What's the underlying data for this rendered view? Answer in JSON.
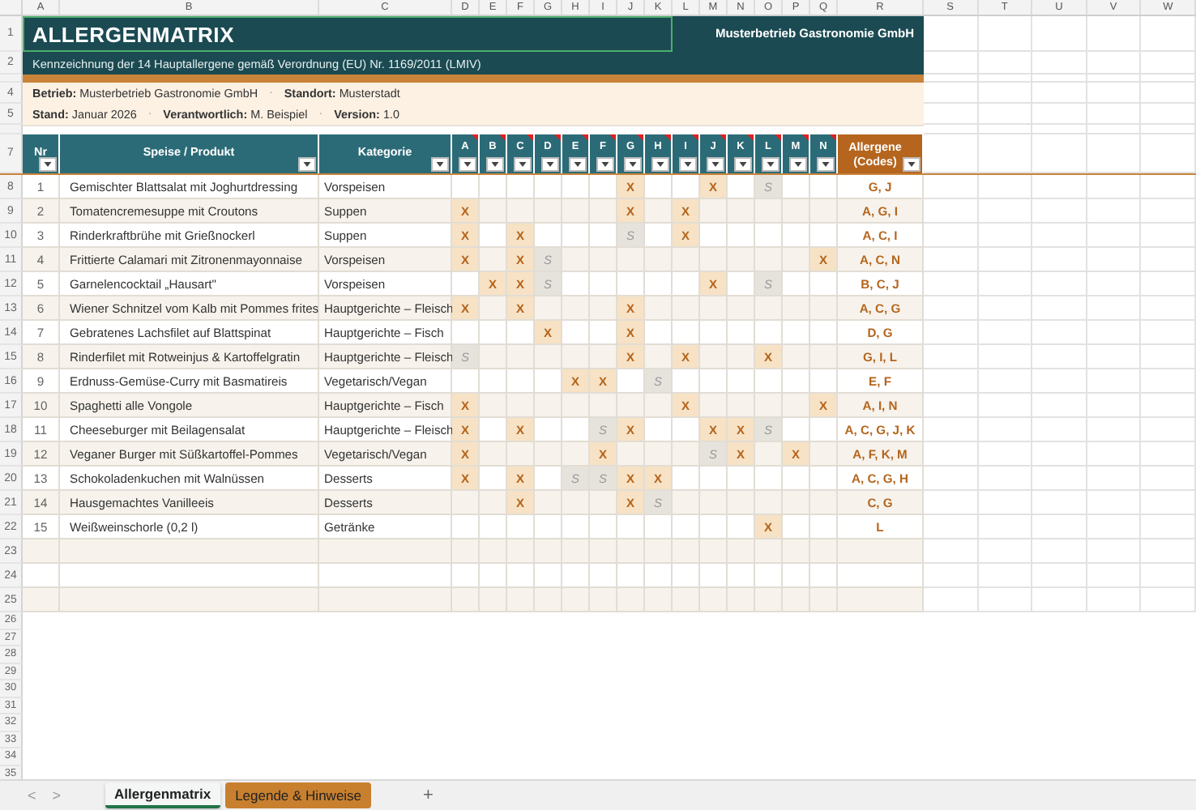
{
  "column_headers": [
    "A",
    "B",
    "C",
    "D",
    "E",
    "F",
    "G",
    "H",
    "I",
    "J",
    "K",
    "L",
    "M",
    "N",
    "O",
    "P",
    "Q",
    "R",
    "S",
    "T",
    "U",
    "V",
    "W"
  ],
  "row_numbers": [
    "1",
    "2",
    "4",
    "5",
    "7",
    "8",
    "9",
    "10",
    "11",
    "12",
    "13",
    "14",
    "15",
    "16",
    "17",
    "18",
    "19",
    "20",
    "21",
    "22",
    "23",
    "24",
    "25",
    "26",
    "27",
    "28",
    "29",
    "30",
    "31",
    "32",
    "33",
    "34",
    "35"
  ],
  "title": "ALLERGENMATRIX",
  "company": "Musterbetrieb Gastronomie GmbH",
  "subtitle": "Kennzeichnung der 14 Hauptallergene gemäß Verordnung (EU) Nr. 1169/2011 (LMIV)",
  "info_lines": [
    [
      "**Betrieb:** Musterbetrieb Gastronomie GmbH",
      "**Standort:** Musterstadt"
    ],
    [
      "**Stand:** Januar 2026",
      "**Verantwortlich:** M. Beispiel",
      "**Version:** 1.0"
    ]
  ],
  "info_separator": "·",
  "table": {
    "columns": [
      "Nr",
      "Speise / Produkt",
      "Kategorie"
    ],
    "allergen_columns": [
      "A",
      "B",
      "C",
      "D",
      "E",
      "F",
      "G",
      "H",
      "I",
      "J",
      "K",
      "L",
      "M",
      "N"
    ],
    "codes_column": "Allergene (Codes)",
    "rows": [
      {
        "nr": "1",
        "dish": "Gemischter Blattsalat mit Joghurtdressing",
        "category": "Vorspeisen",
        "marks": [
          {
            "kind": "none"
          },
          {
            "kind": "none"
          },
          {
            "kind": "none"
          },
          {
            "kind": "none"
          },
          {
            "kind": "none"
          },
          {
            "kind": "none"
          },
          {
            "kind": "contains",
            "text": "X"
          },
          {
            "kind": "none"
          },
          {
            "kind": "none"
          },
          {
            "kind": "contains",
            "text": "X"
          },
          {
            "kind": "none"
          },
          {
            "kind": "trace",
            "text": "S"
          },
          {
            "kind": "none"
          },
          {
            "kind": "none"
          }
        ],
        "codes": "G, J"
      },
      {
        "nr": "2",
        "dish": "Tomatencremesuppe mit Croutons",
        "category": "Suppen",
        "marks": [
          {
            "kind": "contains",
            "text": "X"
          },
          {
            "kind": "none"
          },
          {
            "kind": "none"
          },
          {
            "kind": "none"
          },
          {
            "kind": "none"
          },
          {
            "kind": "none"
          },
          {
            "kind": "contains",
            "text": "X"
          },
          {
            "kind": "none"
          },
          {
            "kind": "contains",
            "text": "X"
          },
          {
            "kind": "none"
          },
          {
            "kind": "none"
          },
          {
            "kind": "none"
          },
          {
            "kind": "none"
          },
          {
            "kind": "none"
          }
        ],
        "codes": "A, G, I"
      },
      {
        "nr": "3",
        "dish": "Rinderkraftbrühe mit Grießnockerl",
        "category": "Suppen",
        "marks": [
          {
            "kind": "contains",
            "text": "X"
          },
          {
            "kind": "none"
          },
          {
            "kind": "contains",
            "text": "X"
          },
          {
            "kind": "none"
          },
          {
            "kind": "none"
          },
          {
            "kind": "none"
          },
          {
            "kind": "trace",
            "text": "S"
          },
          {
            "kind": "none"
          },
          {
            "kind": "contains",
            "text": "X"
          },
          {
            "kind": "none"
          },
          {
            "kind": "none"
          },
          {
            "kind": "none"
          },
          {
            "kind": "none"
          },
          {
            "kind": "none"
          }
        ],
        "codes": "A, C, I"
      },
      {
        "nr": "4",
        "dish": "Frittierte Calamari mit Zitronenmayonnaise",
        "category": "Vorspeisen",
        "marks": [
          {
            "kind": "contains",
            "text": "X"
          },
          {
            "kind": "none"
          },
          {
            "kind": "contains",
            "text": "X"
          },
          {
            "kind": "trace",
            "text": "S"
          },
          {
            "kind": "none"
          },
          {
            "kind": "none"
          },
          {
            "kind": "none"
          },
          {
            "kind": "none"
          },
          {
            "kind": "none"
          },
          {
            "kind": "none"
          },
          {
            "kind": "none"
          },
          {
            "kind": "none"
          },
          {
            "kind": "none"
          },
          {
            "kind": "contains",
            "text": "X"
          }
        ],
        "codes": "A, C, N"
      },
      {
        "nr": "5",
        "dish": "Garnelencocktail „Hausart\"",
        "category": "Vorspeisen",
        "marks": [
          {
            "kind": "none"
          },
          {
            "kind": "contains",
            "text": "X"
          },
          {
            "kind": "contains",
            "text": "X"
          },
          {
            "kind": "trace",
            "text": "S"
          },
          {
            "kind": "none"
          },
          {
            "kind": "none"
          },
          {
            "kind": "none"
          },
          {
            "kind": "none"
          },
          {
            "kind": "none"
          },
          {
            "kind": "contains",
            "text": "X"
          },
          {
            "kind": "none"
          },
          {
            "kind": "trace",
            "text": "S"
          },
          {
            "kind": "none"
          },
          {
            "kind": "none"
          }
        ],
        "codes": "B, C, J"
      },
      {
        "nr": "6",
        "dish": "Wiener Schnitzel vom Kalb mit Pommes frites",
        "category": "Hauptgerichte – Fleisch",
        "marks": [
          {
            "kind": "contains",
            "text": "X"
          },
          {
            "kind": "none"
          },
          {
            "kind": "contains",
            "text": "X"
          },
          {
            "kind": "none"
          },
          {
            "kind": "none"
          },
          {
            "kind": "none"
          },
          {
            "kind": "contains",
            "text": "X"
          },
          {
            "kind": "none"
          },
          {
            "kind": "none"
          },
          {
            "kind": "none"
          },
          {
            "kind": "none"
          },
          {
            "kind": "none"
          },
          {
            "kind": "none"
          },
          {
            "kind": "none"
          }
        ],
        "codes": "A, C, G"
      },
      {
        "nr": "7",
        "dish": "Gebratenes Lachsfilet auf Blattspinat",
        "category": "Hauptgerichte – Fisch",
        "marks": [
          {
            "kind": "none"
          },
          {
            "kind": "none"
          },
          {
            "kind": "none"
          },
          {
            "kind": "contains",
            "text": "X"
          },
          {
            "kind": "none"
          },
          {
            "kind": "none"
          },
          {
            "kind": "contains",
            "text": "X"
          },
          {
            "kind": "none"
          },
          {
            "kind": "none"
          },
          {
            "kind": "none"
          },
          {
            "kind": "none"
          },
          {
            "kind": "none"
          },
          {
            "kind": "none"
          },
          {
            "kind": "none"
          }
        ],
        "codes": "D, G"
      },
      {
        "nr": "8",
        "dish": "Rinderfilet mit Rotweinjus & Kartoffelgratin",
        "category": "Hauptgerichte – Fleisch",
        "marks": [
          {
            "kind": "trace",
            "text": "S"
          },
          {
            "kind": "none"
          },
          {
            "kind": "none"
          },
          {
            "kind": "none"
          },
          {
            "kind": "none"
          },
          {
            "kind": "none"
          },
          {
            "kind": "contains",
            "text": "X"
          },
          {
            "kind": "none"
          },
          {
            "kind": "contains",
            "text": "X"
          },
          {
            "kind": "none"
          },
          {
            "kind": "none"
          },
          {
            "kind": "contains",
            "text": "X"
          },
          {
            "kind": "none"
          },
          {
            "kind": "none"
          }
        ],
        "codes": "G, I, L"
      },
      {
        "nr": "9",
        "dish": "Erdnuss-Gemüse-Curry mit Basmatireis",
        "category": "Vegetarisch/Vegan",
        "marks": [
          {
            "kind": "none"
          },
          {
            "kind": "none"
          },
          {
            "kind": "none"
          },
          {
            "kind": "none"
          },
          {
            "kind": "contains",
            "text": "X"
          },
          {
            "kind": "contains",
            "text": "X"
          },
          {
            "kind": "none"
          },
          {
            "kind": "trace",
            "text": "S"
          },
          {
            "kind": "none"
          },
          {
            "kind": "none"
          },
          {
            "kind": "none"
          },
          {
            "kind": "none"
          },
          {
            "kind": "none"
          },
          {
            "kind": "none"
          }
        ],
        "codes": "E, F"
      },
      {
        "nr": "10",
        "dish": "Spaghetti alle Vongole",
        "category": "Hauptgerichte – Fisch",
        "marks": [
          {
            "kind": "contains",
            "text": "X"
          },
          {
            "kind": "none"
          },
          {
            "kind": "none"
          },
          {
            "kind": "none"
          },
          {
            "kind": "none"
          },
          {
            "kind": "none"
          },
          {
            "kind": "none"
          },
          {
            "kind": "none"
          },
          {
            "kind": "contains",
            "text": "X"
          },
          {
            "kind": "none"
          },
          {
            "kind": "none"
          },
          {
            "kind": "none"
          },
          {
            "kind": "none"
          },
          {
            "kind": "contains",
            "text": "X"
          }
        ],
        "codes": "A, I, N"
      },
      {
        "nr": "11",
        "dish": "Cheeseburger mit Beilagensalat",
        "category": "Hauptgerichte – Fleisch",
        "marks": [
          {
            "kind": "contains",
            "text": "X"
          },
          {
            "kind": "none"
          },
          {
            "kind": "contains",
            "text": "X"
          },
          {
            "kind": "none"
          },
          {
            "kind": "none"
          },
          {
            "kind": "trace",
            "text": "S"
          },
          {
            "kind": "contains",
            "text": "X"
          },
          {
            "kind": "none"
          },
          {
            "kind": "none"
          },
          {
            "kind": "contains",
            "text": "X"
          },
          {
            "kind": "contains",
            "text": "X"
          },
          {
            "kind": "trace",
            "text": "S"
          },
          {
            "kind": "none"
          },
          {
            "kind": "none"
          }
        ],
        "codes": "A, C, G, J, K"
      },
      {
        "nr": "12",
        "dish": "Veganer Burger mit Süßkartoffel-Pommes",
        "category": "Vegetarisch/Vegan",
        "marks": [
          {
            "kind": "contains",
            "text": "X"
          },
          {
            "kind": "none"
          },
          {
            "kind": "none"
          },
          {
            "kind": "none"
          },
          {
            "kind": "none"
          },
          {
            "kind": "contains",
            "text": "X"
          },
          {
            "kind": "none"
          },
          {
            "kind": "none"
          },
          {
            "kind": "none"
          },
          {
            "kind": "trace",
            "text": "S"
          },
          {
            "kind": "contains",
            "text": "X"
          },
          {
            "kind": "none"
          },
          {
            "kind": "contains",
            "text": "X"
          },
          {
            "kind": "none"
          }
        ],
        "codes": "A, F, K, M"
      },
      {
        "nr": "13",
        "dish": "Schokoladenkuchen mit Walnüssen",
        "category": "Desserts",
        "marks": [
          {
            "kind": "contains",
            "text": "X"
          },
          {
            "kind": "none"
          },
          {
            "kind": "contains",
            "text": "X"
          },
          {
            "kind": "none"
          },
          {
            "kind": "trace",
            "text": "S"
          },
          {
            "kind": "trace",
            "text": "S"
          },
          {
            "kind": "contains",
            "text": "X"
          },
          {
            "kind": "contains",
            "text": "X"
          },
          {
            "kind": "none"
          },
          {
            "kind": "none"
          },
          {
            "kind": "none"
          },
          {
            "kind": "none"
          },
          {
            "kind": "none"
          },
          {
            "kind": "none"
          }
        ],
        "codes": "A, C, G, H"
      },
      {
        "nr": "14",
        "dish": "Hausgemachtes Vanilleeis",
        "category": "Desserts",
        "marks": [
          {
            "kind": "none"
          },
          {
            "kind": "none"
          },
          {
            "kind": "contains",
            "text": "X"
          },
          {
            "kind": "none"
          },
          {
            "kind": "none"
          },
          {
            "kind": "none"
          },
          {
            "kind": "contains",
            "text": "X"
          },
          {
            "kind": "trace",
            "text": "S"
          },
          {
            "kind": "none"
          },
          {
            "kind": "none"
          },
          {
            "kind": "none"
          },
          {
            "kind": "none"
          },
          {
            "kind": "none"
          },
          {
            "kind": "none"
          }
        ],
        "codes": "C, G"
      },
      {
        "nr": "15",
        "dish": "Weißweinschorle (0,2 l)",
        "category": "Getränke",
        "marks": [
          {
            "kind": "none"
          },
          {
            "kind": "none"
          },
          {
            "kind": "none"
          },
          {
            "kind": "none"
          },
          {
            "kind": "none"
          },
          {
            "kind": "none"
          },
          {
            "kind": "none"
          },
          {
            "kind": "none"
          },
          {
            "kind": "none"
          },
          {
            "kind": "none"
          },
          {
            "kind": "none"
          },
          {
            "kind": "contains",
            "text": "X"
          },
          {
            "kind": "none"
          },
          {
            "kind": "none"
          }
        ],
        "codes": "L"
      }
    ]
  },
  "tab_nav": [
    "<",
    ">"
  ],
  "tabs": [
    {
      "label": "Allergenmatrix",
      "selected": true
    },
    {
      "label": "Legende & Hinweise",
      "selected": false,
      "color": "#c8802f"
    }
  ],
  "add_sheet": "+"
}
